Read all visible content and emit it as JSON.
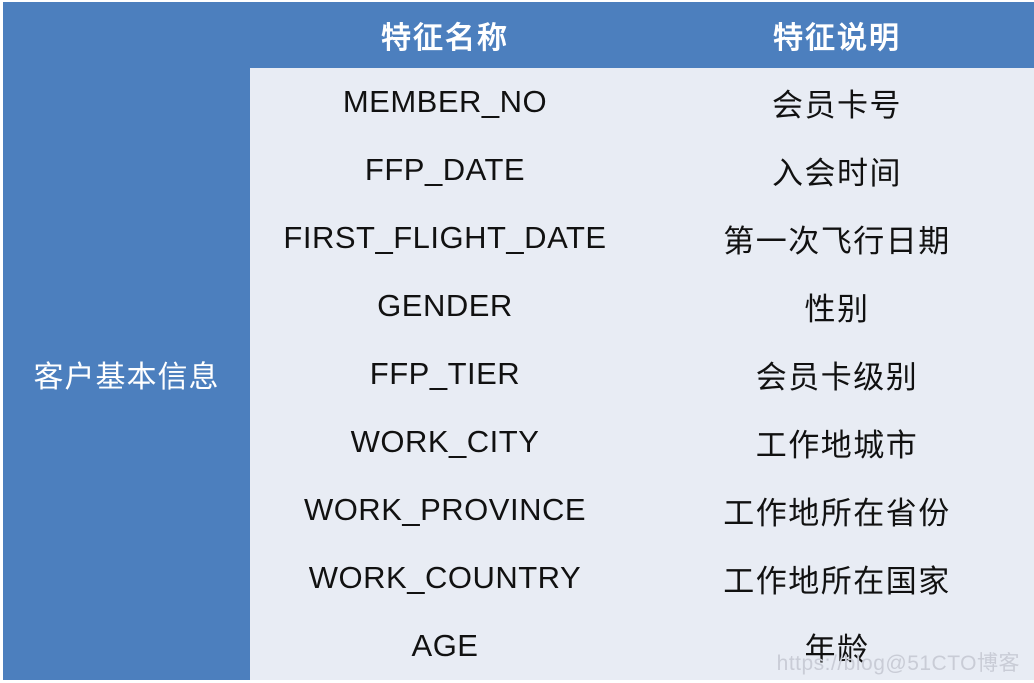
{
  "table": {
    "colors": {
      "header_blue": "#4C7FBE",
      "cell_background": "#E8ECF4",
      "grid_line": "#FFFFFF",
      "header_text": "#FFFFFF",
      "cell_text": "#111111",
      "watermark_text": "#C9CCD6"
    },
    "corner_label": "",
    "headers": {
      "feature_name": "特征名称",
      "feature_description": "特征说明"
    },
    "group_label": "客户基本信息",
    "rows": [
      {
        "name": "MEMBER_NO",
        "description": "会员卡号"
      },
      {
        "name": "FFP_DATE",
        "description": "入会时间"
      },
      {
        "name": "FIRST_FLIGHT_DATE",
        "description": "第一次飞行日期"
      },
      {
        "name": "GENDER",
        "description": "性别"
      },
      {
        "name": "FFP_TIER",
        "description": "会员卡级别"
      },
      {
        "name": "WORK_CITY",
        "description": "工作地城市"
      },
      {
        "name": "WORK_PROVINCE",
        "description": "工作地所在省份"
      },
      {
        "name": "WORK_COUNTRY",
        "description": "工作地所在国家"
      },
      {
        "name": "AGE",
        "description": "年龄"
      }
    ]
  },
  "watermark": "https://blog@51CTO博客"
}
